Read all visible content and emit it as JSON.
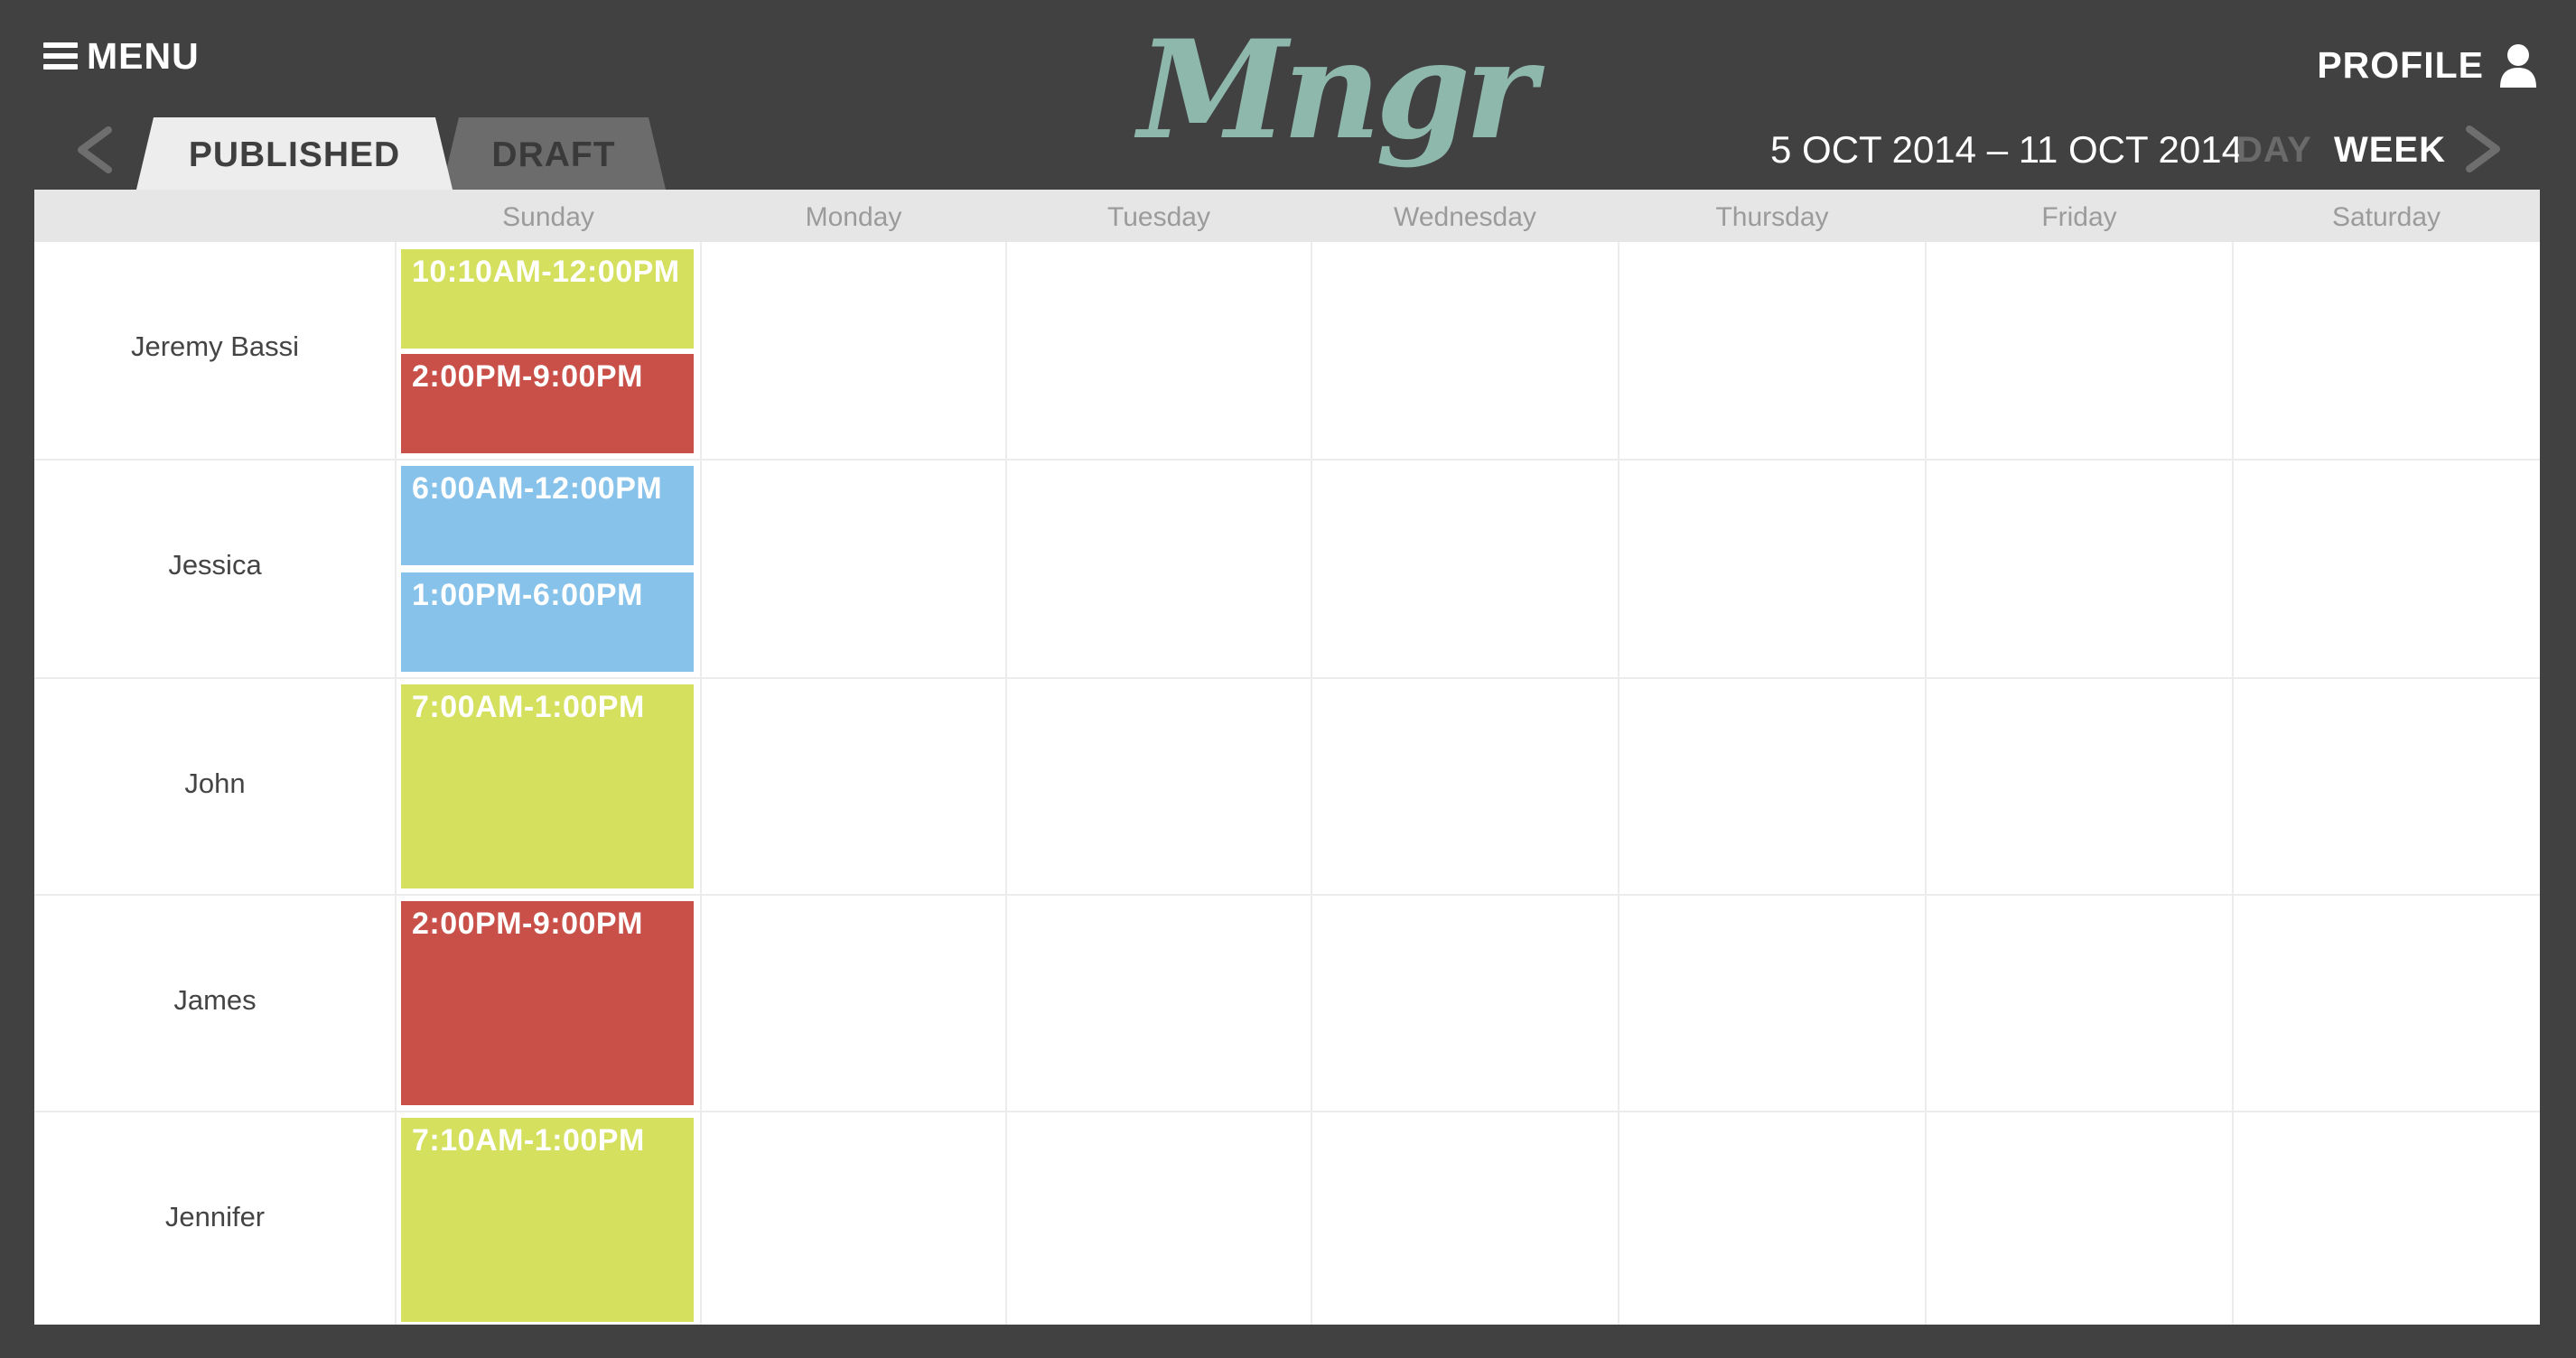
{
  "header": {
    "menu_label": "MENU",
    "logo_text": "Mngr",
    "profile_label": "PROFILE",
    "tabs": [
      {
        "label": "PUBLISHED",
        "active": true
      },
      {
        "label": "DRAFT",
        "active": false
      }
    ],
    "date_range": "5 OCT 2014 – 11 OCT 2014",
    "view_day": "DAY",
    "view_week": "WEEK",
    "active_view": "WEEK"
  },
  "days": [
    "Sunday",
    "Monday",
    "Tuesday",
    "Wednesday",
    "Thursday",
    "Friday",
    "Saturday"
  ],
  "employees": [
    {
      "name": "Jeremy Bassi"
    },
    {
      "name": "Jessica"
    },
    {
      "name": "John"
    },
    {
      "name": "James"
    },
    {
      "name": "Jennifer"
    }
  ],
  "shifts": [
    {
      "employee": "Jeremy Bassi",
      "day": "Sunday",
      "label": "10:10AM-12:00PM",
      "color": "#d4e05e"
    },
    {
      "employee": "Jeremy Bassi",
      "day": "Sunday",
      "label": "2:00PM-9:00PM",
      "color": "#c85048"
    },
    {
      "employee": "Jessica",
      "day": "Sunday",
      "label": "6:00AM-12:00PM",
      "color": "#87c2eb"
    },
    {
      "employee": "Jessica",
      "day": "Sunday",
      "label": "1:00PM-6:00PM",
      "color": "#87c2eb"
    },
    {
      "employee": "John",
      "day": "Sunday",
      "label": "7:00AM-1:00PM",
      "color": "#d4e05e"
    },
    {
      "employee": "James",
      "day": "Sunday",
      "label": "2:00PM-9:00PM",
      "color": "#c85048"
    },
    {
      "employee": "Jennifer",
      "day": "Sunday",
      "label": "7:10AM-1:00PM",
      "color": "#d4e05e"
    }
  ],
  "colors": {
    "background": "#414141",
    "accent_logo": "#8fb8ad",
    "shift_yellow": "#d4e05e",
    "shift_red": "#c85048",
    "shift_blue": "#87c2eb"
  },
  "icons": {
    "menu": "menu-icon",
    "profile": "user-icon",
    "prev": "chevron-left-icon",
    "next": "chevron-right-icon"
  }
}
